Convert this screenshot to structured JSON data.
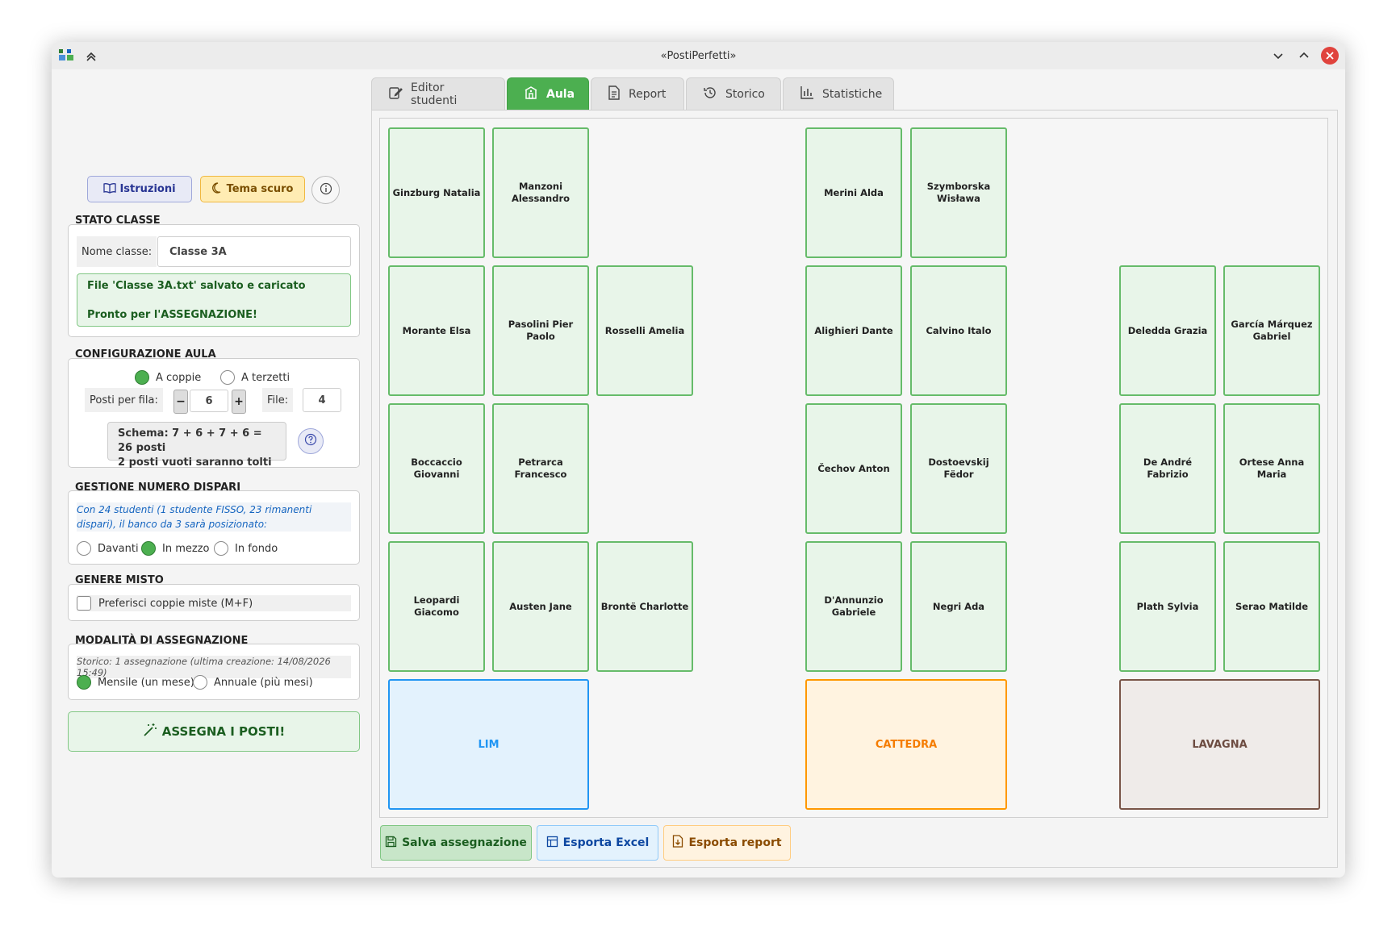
{
  "window": {
    "title": "«PostiPerfetti»"
  },
  "tabs": [
    {
      "label": "Editor studenti",
      "icon": "edit-icon"
    },
    {
      "label": "Aula",
      "icon": "classroom-icon"
    },
    {
      "label": "Report",
      "icon": "document-icon"
    },
    {
      "label": "Storico",
      "icon": "history-icon"
    },
    {
      "label": "Statistiche",
      "icon": "bar-chart-icon"
    }
  ],
  "toolbar": {
    "instructions_label": "Istruzioni",
    "dark_theme_label": "Tema scuro"
  },
  "class_status": {
    "title": "STATO CLASSE",
    "name_label": "Nome classe:",
    "name_value": "Classe 3A",
    "status_line1": "File 'Classe 3A.txt' salvato e caricato",
    "status_line2": "Pronto per l'ASSEGNAZIONE!"
  },
  "room_config": {
    "title": "CONFIGURAZIONE AULA",
    "mode_pairs": "A coppie",
    "mode_triplets": "A terzetti",
    "seats_per_row_label": "Posti per fila:",
    "seats_per_row_value": "6",
    "rows_label": "File:",
    "rows_value": "4",
    "schema_line1": "Schema: 7 + 6 + 7 + 6 = 26 posti",
    "schema_line2": "2 posti vuoti saranno tolti"
  },
  "odd_number": {
    "title": "GESTIONE NUMERO DISPARI",
    "info": "Con 24 studenti (1 studente FISSO, 23 rimanenti dispari), il banco da 3 sarà posizionato:",
    "opt_front": "Davanti",
    "opt_middle": "In mezzo",
    "opt_back": "In fondo"
  },
  "mixed_gender": {
    "title": "GENERE MISTO",
    "checkbox_label": "Preferisci coppie miste (M+F)"
  },
  "assignment_mode": {
    "title": "MODALITÀ DI ASSEGNAZIONE",
    "history_info": "Storico: 1 assegnazione (ultima creazione: 14/08/2026 15:49)",
    "opt_monthly": "Mensile (un mese)",
    "opt_yearly": "Annuale (più mesi)"
  },
  "assign_button": "ASSEGNA I POSTI!",
  "seats": [
    "Ginzburg Natalia",
    "Manzoni Alessandro",
    "Merini Alda",
    "Szymborska Wisława",
    "Morante Elsa",
    "Pasolini Pier Paolo",
    "Rosselli Amelia",
    "Alighieri Dante",
    "Calvino Italo",
    "Deledda Grazia",
    "García Márquez Gabriel",
    "Boccaccio Giovanni",
    "Petrarca Francesco",
    "Čechov Anton",
    "Dostoevskij Fëdor",
    "De André Fabrizio",
    "Ortese Anna Maria",
    "Leopardi Giacomo",
    "Austen Jane",
    "Brontë Charlotte",
    "D'Annunzio Gabriele",
    "Negri Ada",
    "Plath Sylvia",
    "Serao Matilde"
  ],
  "boards": {
    "lim": "LIM",
    "cattedra": "CATTEDRA",
    "lavagna": "LAVAGNA"
  },
  "colors": {
    "accent": "#4caf50",
    "lim": "#2196f3",
    "cattedra": "#ff9800",
    "lavagna": "#795548"
  },
  "bottom_buttons": {
    "save": "Salva assegnazione",
    "excel": "Esporta Excel",
    "report": "Esporta report"
  }
}
